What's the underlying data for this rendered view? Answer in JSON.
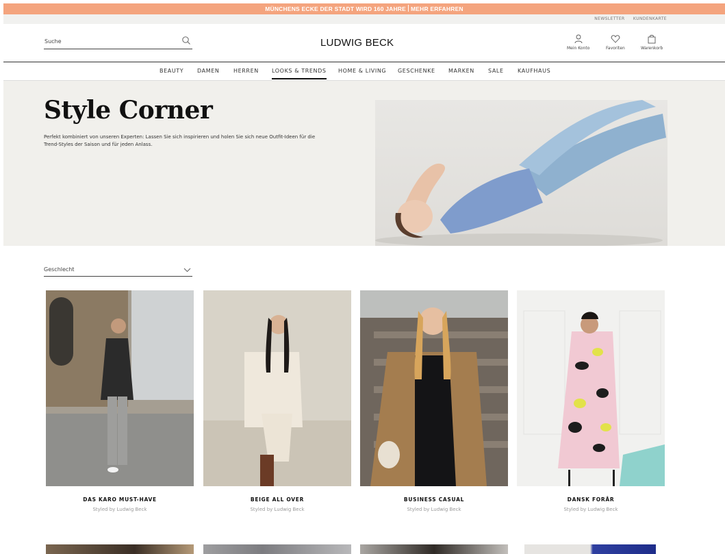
{
  "promo": {
    "text_a": "MÜNCHENS ECKE DER STADT WIRD 160 JAHRE",
    "text_b": "MEHR ERFAHREN"
  },
  "toplinks": [
    "NEWSLETTER",
    "KUNDENKARTE"
  ],
  "header": {
    "search_label": "Suche",
    "logo": "LUDWIG BECK",
    "account_label": "Mein Konto",
    "favorites_label": "Favoriten",
    "cart_label": "Warenkorb"
  },
  "nav": [
    "BEAUTY",
    "DAMEN",
    "HERREN",
    "LOOKS & TRENDS",
    "HOME & LIVING",
    "GESCHENKE",
    "MARKEN",
    "SALE",
    "KAUFHAUS"
  ],
  "nav_active": "LOOKS & TRENDS",
  "hero": {
    "title": "Style Corner",
    "text": "Perfekt kombiniert von unseren Experten: Lassen Sie sich inspirieren und holen Sie sich neue Outfit-Ideen für die Trend-Styles der Saison und für jeden Anlass."
  },
  "filter": {
    "label": "Geschlecht"
  },
  "cards": [
    {
      "title": "DAS KARO MUST-HAVE",
      "subtitle": "Styled by Ludwig Beck"
    },
    {
      "title": "BEIGE ALL OVER",
      "subtitle": "Styled by Ludwig Beck"
    },
    {
      "title": "BUSINESS CASUAL",
      "subtitle": "Styled by Ludwig Beck"
    },
    {
      "title": "DANSK FORÅR",
      "subtitle": "Styled by Ludwig Beck"
    }
  ],
  "colors": {
    "promo": "#f4a47e",
    "hero_bg": "#f1f0ec",
    "text": "#222222"
  }
}
